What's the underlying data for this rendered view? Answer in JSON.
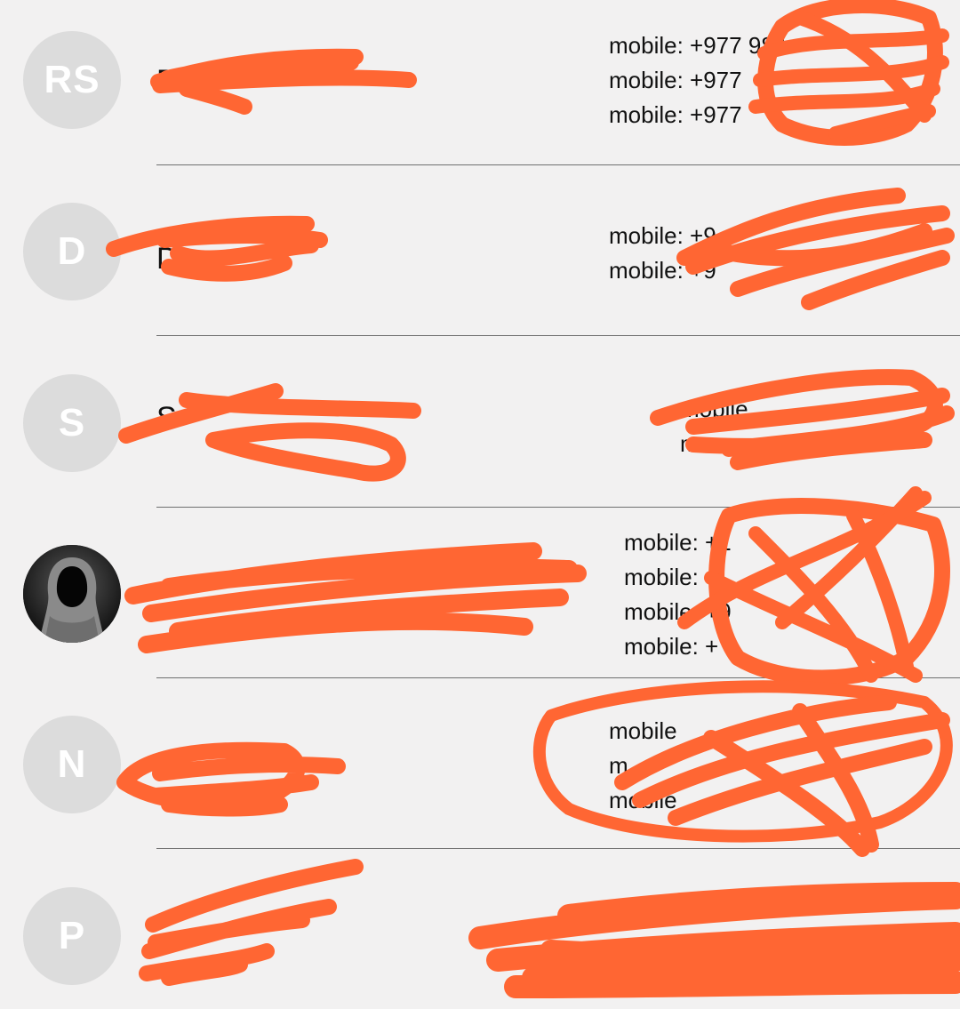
{
  "contacts": [
    {
      "initials": "RS",
      "name": "R",
      "phones": [
        "mobile: +977 984",
        "mobile: +977",
        "mobile: +977"
      ]
    },
    {
      "initials": "D",
      "name": "D",
      "phones": [
        "mobile: +9",
        "mobile: +9"
      ]
    },
    {
      "initials": "S",
      "name": "S",
      "phones": [
        "mobile",
        "m"
      ]
    },
    {
      "initials": "",
      "avatar_icon": "hooded-figure-photo",
      "name": "",
      "phones": [
        "mobile: +1",
        "mobile: +",
        "mobile: +9",
        "mobile: +"
      ]
    },
    {
      "initials": "N",
      "name": "N",
      "phones": [
        "mobile",
        "m",
        "mobile"
      ]
    },
    {
      "initials": "P",
      "name": "",
      "phones": []
    }
  ],
  "colors": {
    "background": "#f2f1f1",
    "avatar_bg": "#dcdcdc",
    "redaction": "#ff6633"
  }
}
